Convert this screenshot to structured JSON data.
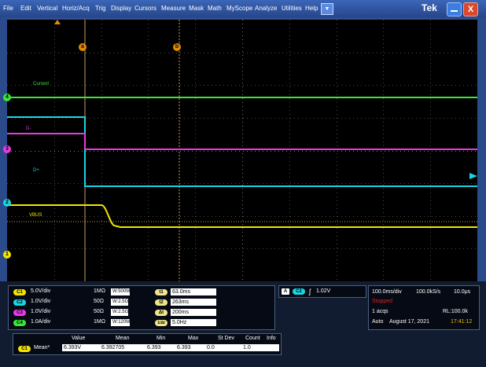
{
  "menu": {
    "items": [
      "File",
      "Edit",
      "Vertical",
      "Horiz/Acq",
      "Trig",
      "Display",
      "Cursors",
      "Measure",
      "Mask",
      "Math",
      "MyScope",
      "Analyze",
      "Utilities",
      "Help"
    ],
    "logo": "Tek",
    "close_glyph": "X"
  },
  "traces": {
    "current_label": "Current",
    "dminus_label": "D-",
    "dplus_label": "D+",
    "vbus_label": "VBUS",
    "colors": {
      "ch1": "#f2e600",
      "ch2": "#19d6e6",
      "ch3": "#e63ce6",
      "ch4": "#39e639"
    }
  },
  "markers": {
    "cursor_a": "a",
    "cursor_b": "b",
    "ch4": "4",
    "ch3": "3",
    "ch2": "2",
    "ch1": "1"
  },
  "channels": [
    {
      "badge": "C1",
      "scale": "5.0V/div",
      "imp": "1MΩ",
      "bw": "W:500M"
    },
    {
      "badge": "C2",
      "scale": "1.0V/div",
      "imp": "50Ω",
      "bw": "W:2.5G"
    },
    {
      "badge": "C3",
      "scale": "1.0V/div",
      "imp": "50Ω",
      "bw": "W:2.5G"
    },
    {
      "badge": "C4",
      "scale": "1.0A/div",
      "imp": "1MΩ",
      "bw": "W:120M"
    }
  ],
  "cursors": [
    {
      "badge": "t1",
      "value": "63.0ms"
    },
    {
      "badge": "t2",
      "value": "263ms"
    },
    {
      "badge": "Δt",
      "value": "200ms"
    },
    {
      "badge": "1/Δt",
      "value": "5.0Hz"
    }
  ],
  "trigger": {
    "mode_badge": "A",
    "source_badge": "C2",
    "level": "1.02V"
  },
  "acquisition": {
    "timebase": "100.0ms/div",
    "sample_rate": "100.0kS/s",
    "resolution": "10.0μs",
    "state": "Stopped",
    "acqs": "1 acqs",
    "record_length": "RL:100.0k",
    "trigger_mode": "Auto",
    "date": "August 17, 2021",
    "time": "17:41:12"
  },
  "measurements": {
    "headers": [
      "Value",
      "Mean",
      "Min",
      "Max",
      "St Dev",
      "Count",
      "Info"
    ],
    "row": {
      "badge": "C1",
      "label": "Mean*",
      "value": "6.393V",
      "mean": "6.392705",
      "min": "6.393",
      "max": "6.393",
      "stdev": "0.0",
      "count": "1.0",
      "info": ""
    }
  }
}
